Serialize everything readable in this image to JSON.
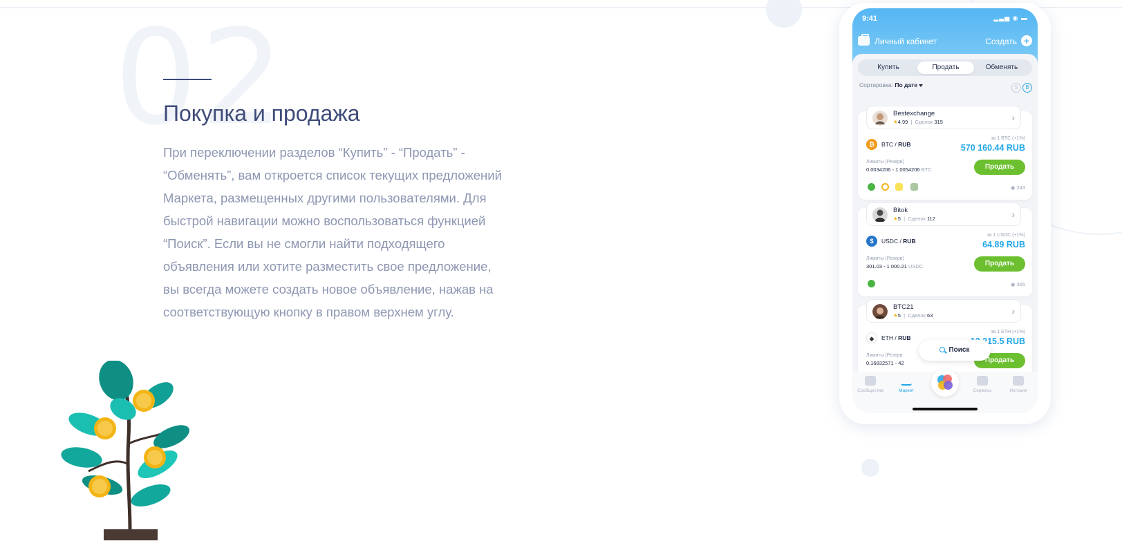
{
  "section": {
    "number": "02",
    "title": "Покупка и продажа",
    "description": "При переключении разделов “Купить” - “Продать” - “Обменять”, вам откроется список текущих предложений Маркета, размещенных другими пользователями. Для быстрой навигации можно воспользоваться функцией “Поиск”. Если вы не смогли найти подходящего объявления или хотите разместить свое предложение, вы всегда можете создать новое объявление, нажав на соответствующую кнопку в правом верхнем углу."
  },
  "phone": {
    "status_time": "9:41",
    "header": {
      "title": "Личный кабинет",
      "create": "Создать",
      "plus": "+"
    },
    "tabs": [
      {
        "label": "Купить"
      },
      {
        "label": "Продать",
        "selected": true
      },
      {
        "label": "Обменять"
      }
    ],
    "sort": {
      "label": "Сортировка:",
      "value": "По дате"
    },
    "offers": [
      {
        "user": "Bestexchange",
        "rating": "4.99",
        "deals_label": "Сделок",
        "deals": "315",
        "coin": "BTC",
        "pair_base": "BTC / ",
        "pair_quote": "RUB",
        "rate_label": "за 1 BTC (+1%)",
        "price": "570 160.44 RUB",
        "limits_label": "Лимиты (Резерв)",
        "limits": "0.0034206 - 1.0054206",
        "limits_unit": "BTC",
        "button": "Продать",
        "views": "243"
      },
      {
        "user": "Bitok",
        "rating": "5",
        "deals_label": "Сделок",
        "deals": "112",
        "coin": "USDC",
        "pair_base": "USDC / ",
        "pair_quote": "RUB",
        "rate_label": "за 1 USDC (+1%)",
        "price": "64.89 RUB",
        "limits_label": "Лимиты (Резерв)",
        "limits": "301.03 - 1 000.21",
        "limits_unit": "USDC",
        "button": "Продать",
        "views": "365"
      },
      {
        "user": "BTC21",
        "rating": "5",
        "deals_label": "Сделок",
        "deals": "63",
        "coin": "ETH",
        "pair_base": "ETH / ",
        "pair_quote": "RUB",
        "rate_label": "за 1 ETH (+1%)",
        "price": "12 215.5 RUB",
        "limits_label": "Лимиты (Резерв",
        "limits": "0.16832571 - 42",
        "limits_unit": "",
        "button": "Продать",
        "views": ""
      }
    ],
    "search": "Поиск",
    "tabbar": [
      {
        "label": "Сообщества"
      },
      {
        "label": "Маркет",
        "active": true
      },
      {
        "label": "Сервисы"
      },
      {
        "label": "История"
      }
    ]
  },
  "colors": {
    "heading": "#3e4b79",
    "accent_blue": "#22a7e8",
    "sell_green": "#6cc02f",
    "body_text": "#8e97b2"
  }
}
